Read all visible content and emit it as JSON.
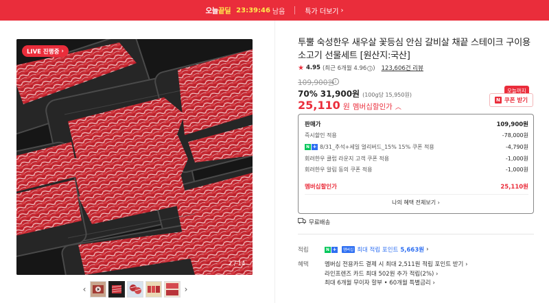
{
  "topbar": {
    "brand_prefix": "오늘",
    "brand_suffix": "끝딜",
    "countdown": "23:39:46",
    "remain_text": "남음",
    "more_label": "특가 더보기",
    "more_icon": "chevron-right-icon",
    "bg_color": "#ea2d3b"
  },
  "gallery": {
    "live_badge": "LIVE 진행중",
    "page_current": "2",
    "page_total": "14",
    "thumb_count": 5,
    "active_thumb": 1
  },
  "product": {
    "title": "투뿔 숙성한우 새우살 꽃등심 안심 갈비살 채끝 스테이크 구이용 소고기 선물세트 [원산지:국산]",
    "rating_score": "4.95",
    "rating_recent": "(최근 6개월 4.96",
    "rating_recent_close": ")",
    "review_count": "123,606건 리뷰",
    "original_price": "109,900원",
    "discount_pct": "70%",
    "sale_price": "31,900원",
    "unit_price": "(100g당 15,950원)",
    "member_price": "25,110",
    "member_won": "원",
    "member_label": "멤버십할인가",
    "coupon_tag": "오늘까지",
    "coupon_button": "쿠폰 받기"
  },
  "breakdown": {
    "rows": [
      {
        "label": "판매가",
        "value": "109,900원"
      },
      {
        "label": "즉시할인 적용",
        "value": "-78,000원"
      },
      {
        "label": "8/31_추석+세일 얼리버드_15% 15% 쿠폰 적용",
        "value": "-4,790원"
      },
      {
        "label": "회려한우 클럽 라운지 고객 쿠폰 적용",
        "value": "-1,000원"
      },
      {
        "label": "회려한우 알림 동의 쿠폰 적용",
        "value": "-1,000원"
      },
      {
        "label": "멤버십할인가",
        "value": "25,110원"
      }
    ],
    "view_all": "나의 혜택 전체보기"
  },
  "delivery": {
    "label": "무료배송"
  },
  "points": {
    "label": "적립",
    "badge": "멤버십",
    "prefix": "최대 적립 포인트",
    "amount": "5,663원"
  },
  "benefits": {
    "label": "혜택",
    "lines": [
      "멤버십 전용카드 결제 시 최대 2,511원 적립 포인트 받기",
      "라인프렌즈 카드 최대 502원 추가 적립(2%)",
      "최대 6개월 무이자 할부 • 60개월 특별금리"
    ]
  }
}
